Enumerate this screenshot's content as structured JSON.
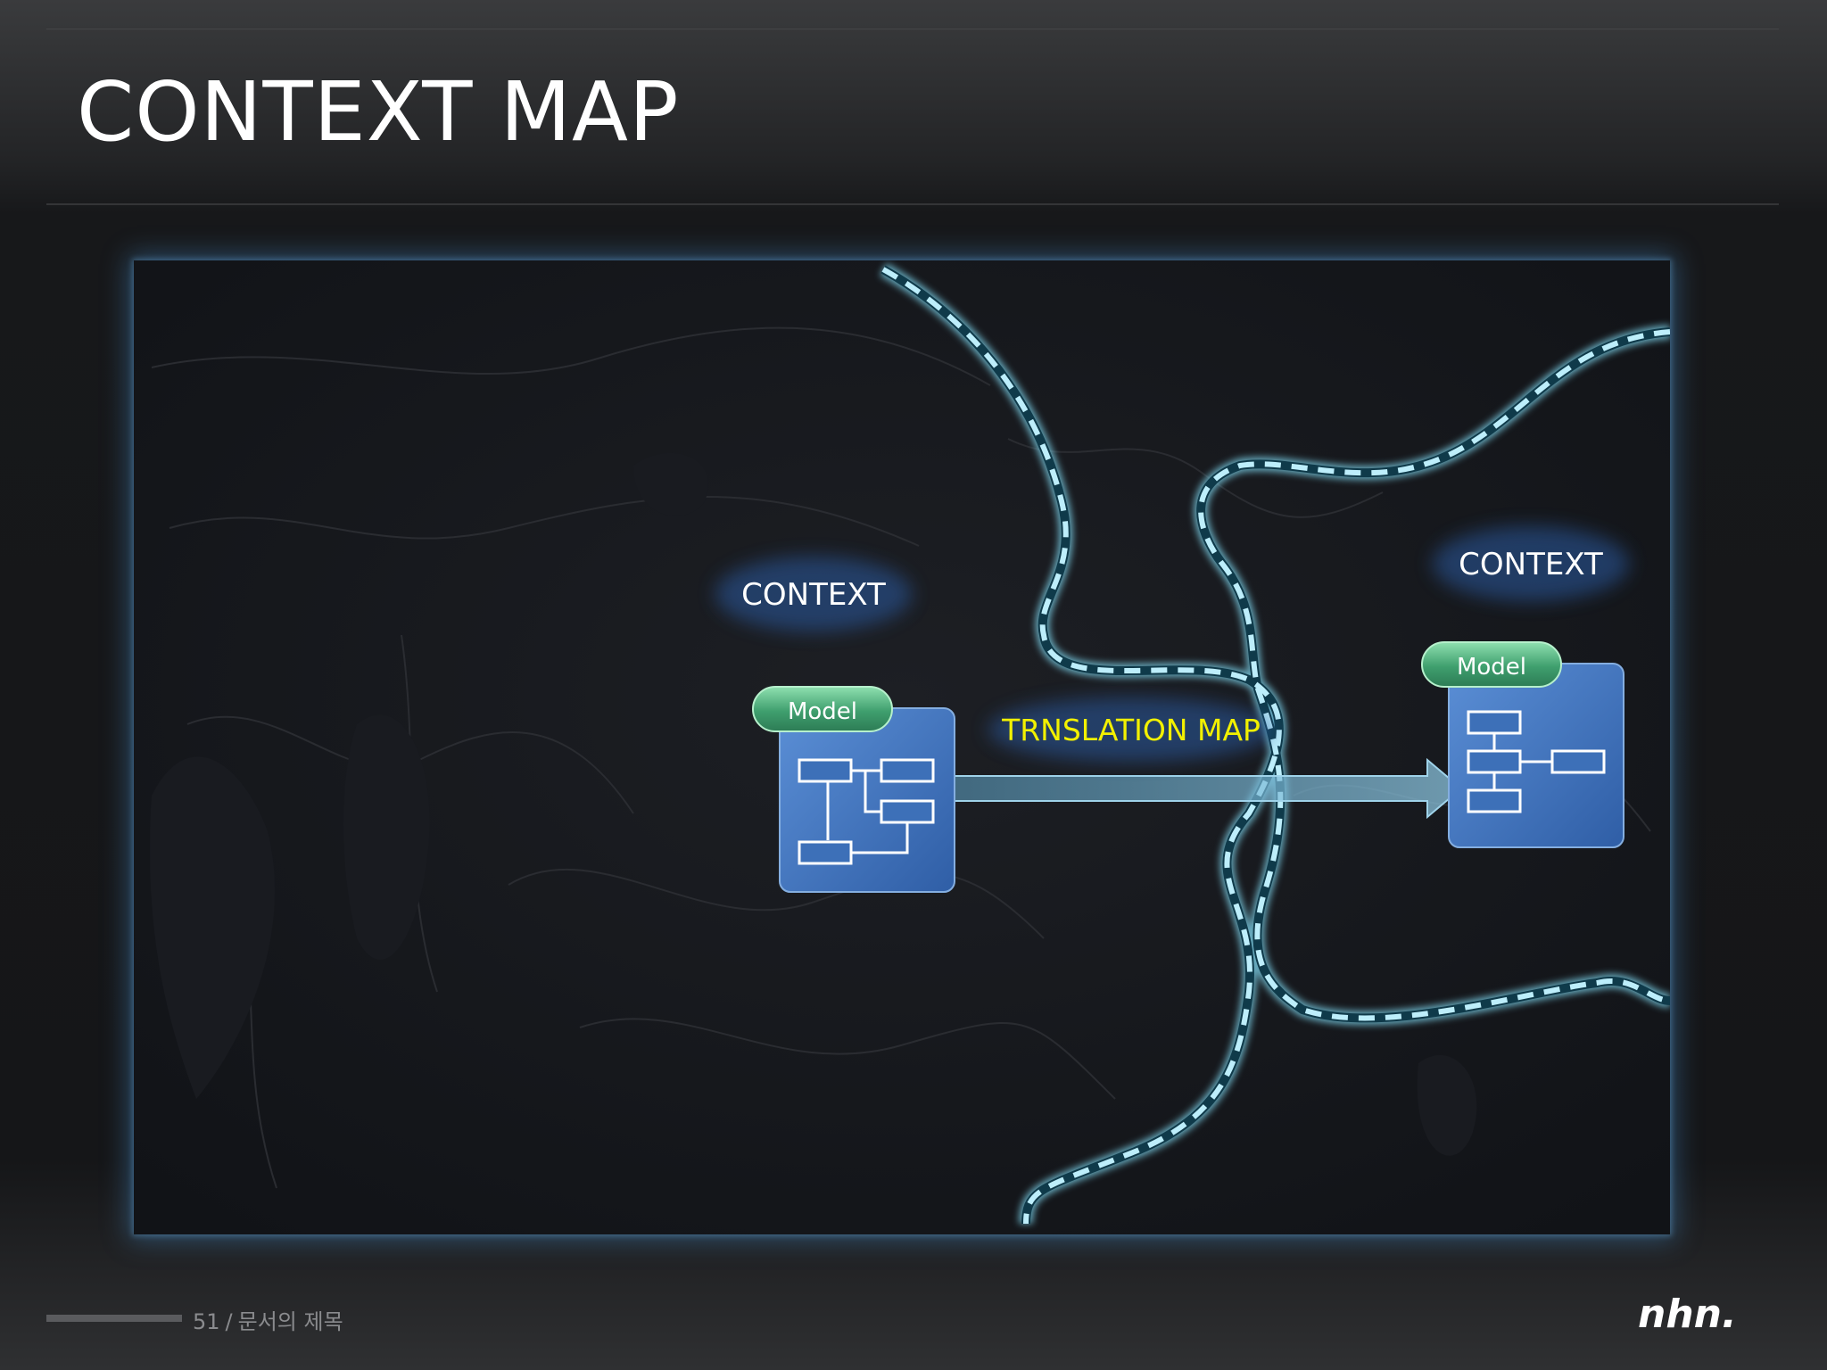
{
  "slide": {
    "title": "CONTEXT MAP",
    "page_number": "51",
    "separator": "/",
    "doc_title": "문서의 제목"
  },
  "diagram": {
    "left_context_label": "CONTEXT",
    "right_context_label": "CONTEXT",
    "left_model_label": "Model",
    "right_model_label": "Model",
    "arrow_label": "TRNSLATION MAP"
  },
  "logo": {
    "name": "nhn-logo",
    "text": "nhn."
  },
  "colors": {
    "title": "#ffffff",
    "dashed_boundary": "#0f3a4a",
    "boundary_glow": "#7fd7ef",
    "model_box": "#3f73b8",
    "model_tag": "#4fa37a",
    "arrow_label": "#f2f000",
    "label_text": "#ffffff"
  }
}
